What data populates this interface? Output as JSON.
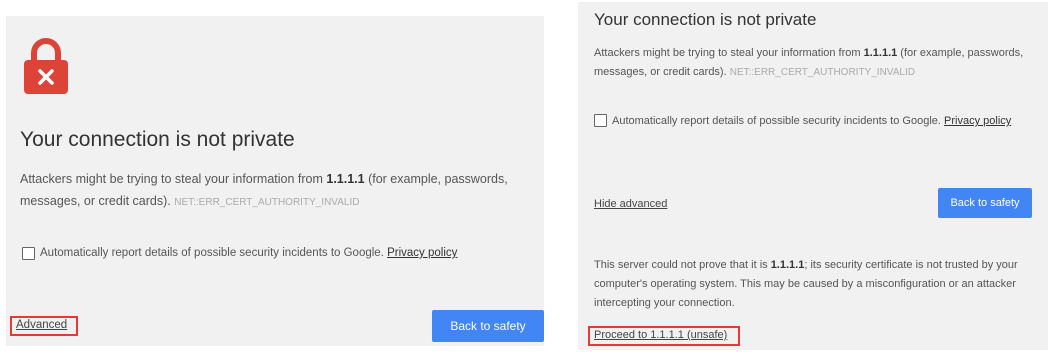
{
  "left": {
    "title": "Your connection is not private",
    "body_prefix": "Attackers might be trying to steal your information from ",
    "host": "1.1.1.1",
    "body_suffix": " (for example, passwords, messages, or credit cards).",
    "error_code": "NET::ERR_CERT_AUTHORITY_INVALID",
    "checkbox_label": "Automatically report details of possible security incidents to Google.",
    "privacy_link": "Privacy policy",
    "advanced_link": "Advanced",
    "back_button": "Back to safety"
  },
  "right": {
    "title": "Your connection is not private",
    "body_prefix": "Attackers might be trying to steal your information from ",
    "host": "1.1.1.1",
    "body_suffix": " (for example, passwords, messages, or credit cards).",
    "error_code": "NET::ERR_CERT_AUTHORITY_INVALID",
    "checkbox_label": "Automatically report details of possible security incidents to Google.",
    "privacy_link": "Privacy policy",
    "hide_advanced_link": "Hide advanced",
    "back_button": "Back to safety",
    "detail_prefix": "This server could not prove that it is ",
    "detail_host": "1.1.1.1",
    "detail_suffix": "; its security certificate is not trusted by your computer's operating system. This may be caused by a misconfiguration or an attacker intercepting your connection.",
    "proceed_link": "Proceed to 1.1.1.1 (unsafe)"
  },
  "colors": {
    "lock_red": "#db4437",
    "button_blue": "#4285f4",
    "highlight_red": "#e53935"
  },
  "icons": {
    "lock": "lock-icon"
  }
}
